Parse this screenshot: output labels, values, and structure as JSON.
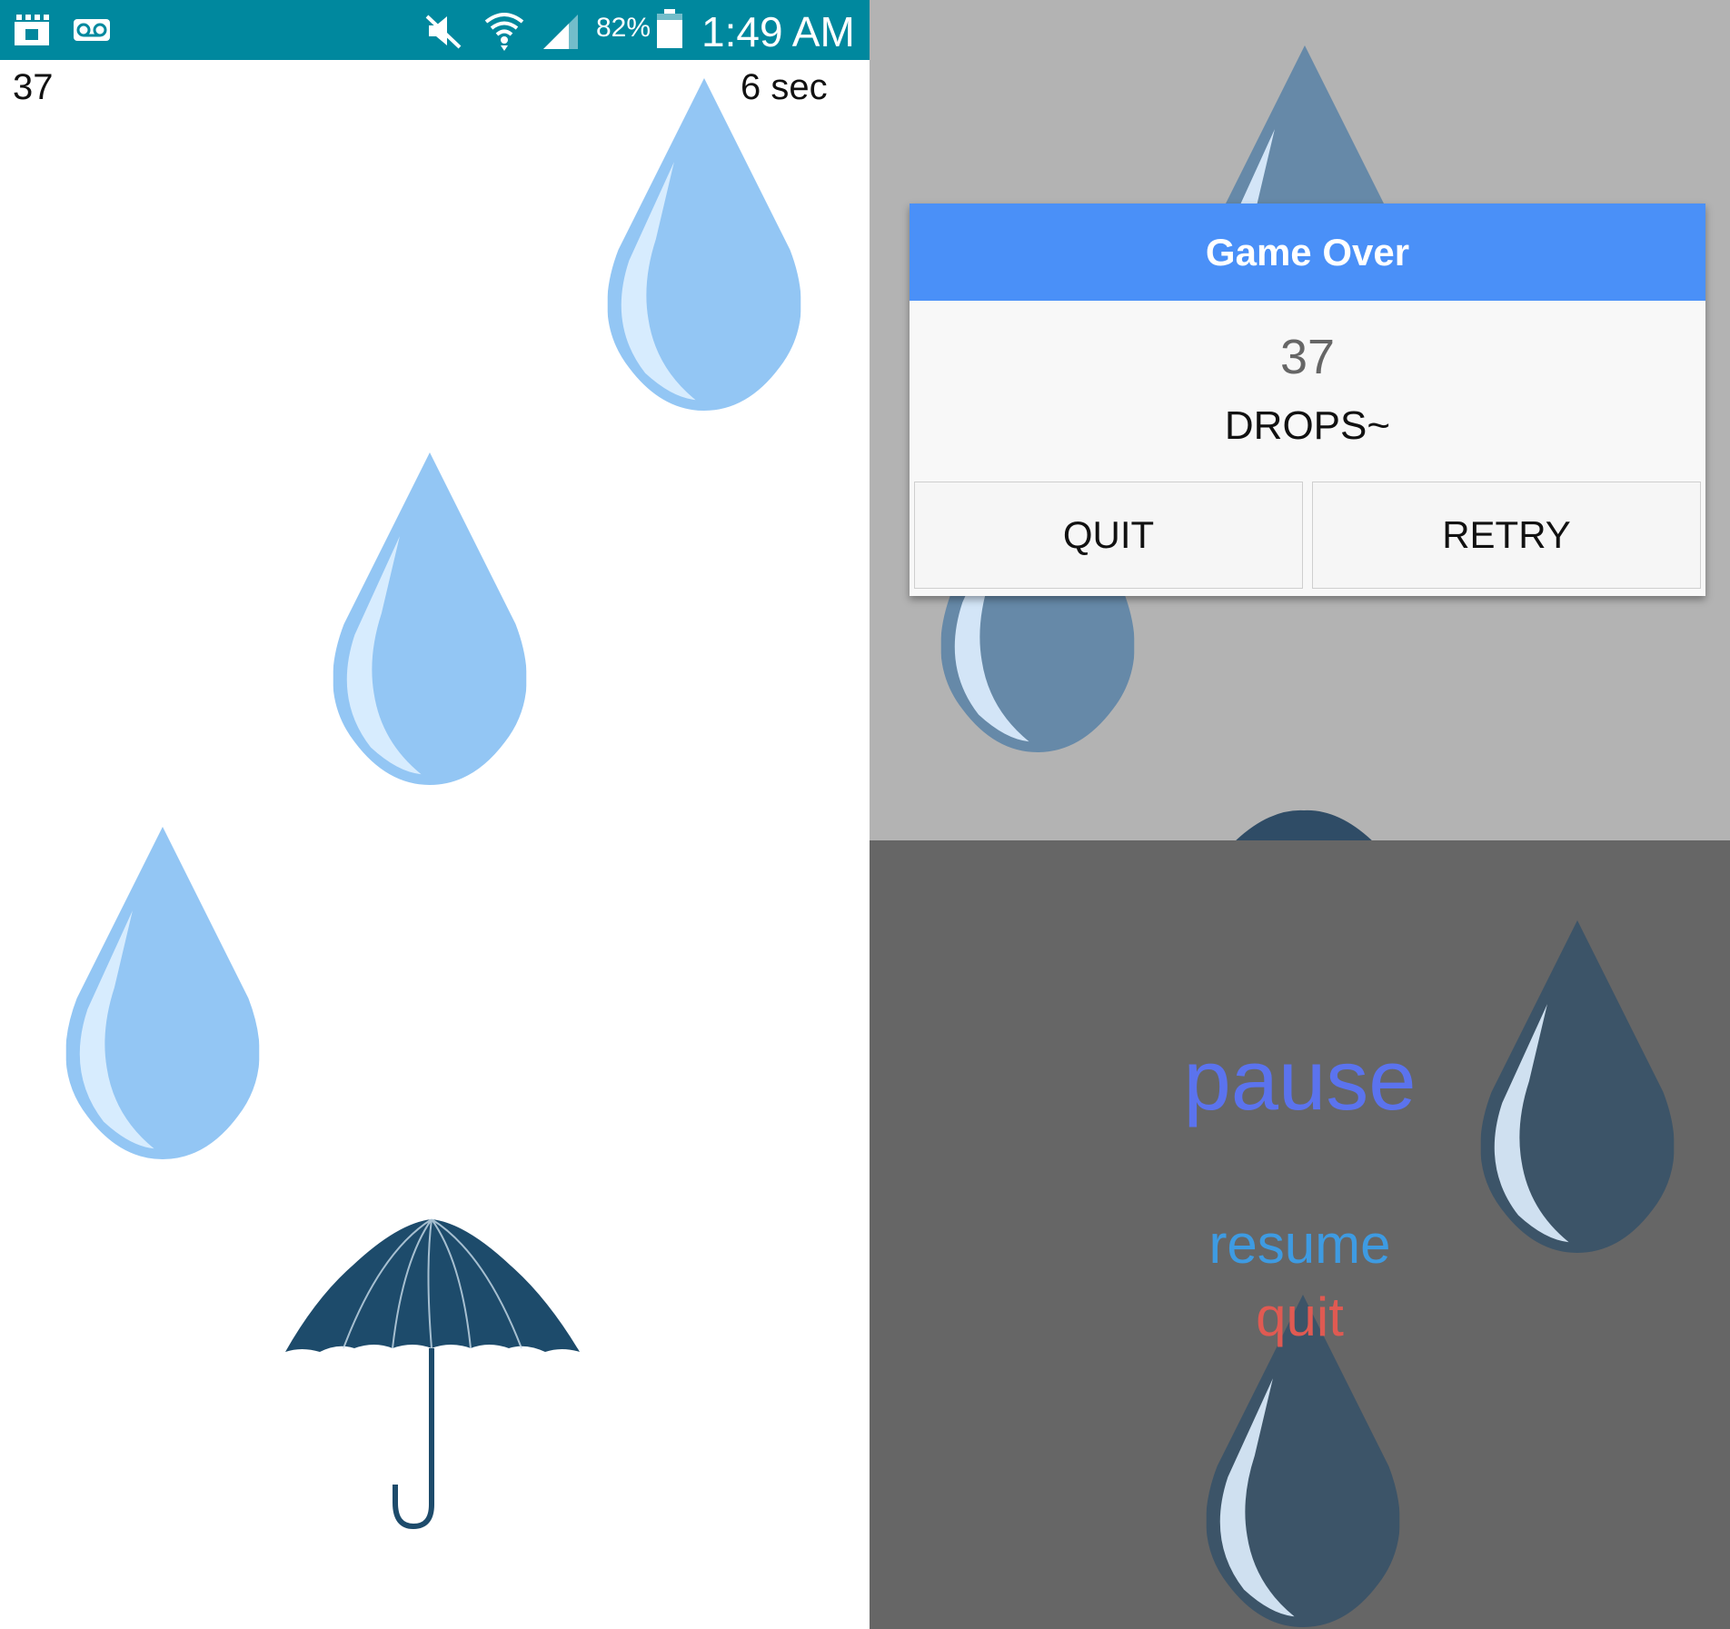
{
  "status_bar": {
    "battery": "82%",
    "time": "1:49 AM",
    "background": "#00889e",
    "icons": [
      "notification-icon",
      "voicemail-icon",
      "mute-icon",
      "wifi-icon",
      "signal-icon",
      "battery-icon"
    ]
  },
  "game": {
    "score": "37",
    "timer": "6 sec"
  },
  "game_over_dialog": {
    "title": "Game Over",
    "score": "37",
    "unit": "DROPS~",
    "quit_label": "QUIT",
    "retry_label": "RETRY",
    "header_color": "#4a90f8"
  },
  "pause_menu": {
    "title": "pause",
    "resume_label": "resume",
    "quit_label": "quit"
  },
  "colors": {
    "drop": "#93c6f4",
    "drop_highlight": "#dff0ff",
    "umbrella": "#1d4b6b",
    "pause_overlay": "#666666",
    "game_over_overlay": "#b3b3b3"
  }
}
